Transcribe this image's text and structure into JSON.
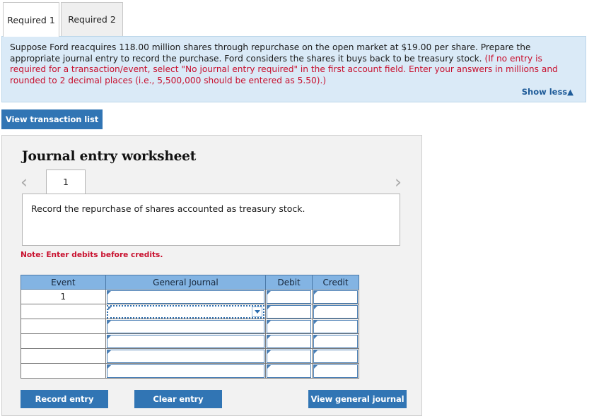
{
  "tabs": [
    {
      "label": "Required 1",
      "active": true
    },
    {
      "label": "Required 2",
      "active": false
    }
  ],
  "instructions": {
    "segment_1": "Suppose Ford reacquires 118.00 million shares through repurchase on the open market at $19.00 per share. Prepare the appropriate journal entry to record the purchase. Ford considers the shares it buys back to be treasury stock. ",
    "segment_2_red": "(If no entry is required for a transaction/event, select \"No journal entry required\" in the first account field. Enter your answers in millions and rounded to 2 decimal places (i.e., 5,500,000 should be entered as 5.50).)",
    "show_less_label": "Show less▲"
  },
  "toolbar": {
    "view_transaction_list_label": "View transaction list"
  },
  "worksheet": {
    "title": "Journal entry worksheet",
    "pager": {
      "prev_icon": "chevron-left-icon",
      "next_icon": "chevron-right-icon",
      "current_page": "1"
    },
    "description": "Record the repurchase of shares accounted as treasury stock.",
    "note": "Note: Enter debits before credits."
  },
  "table": {
    "columns": [
      "Event",
      "General Journal",
      "Debit",
      "Credit"
    ],
    "rows": [
      {
        "event": "1",
        "general_journal": "",
        "debit": "",
        "credit": "",
        "selected": false
      },
      {
        "event": "",
        "general_journal": "",
        "debit": "",
        "credit": "",
        "selected": true
      },
      {
        "event": "",
        "general_journal": "",
        "debit": "",
        "credit": "",
        "selected": false
      },
      {
        "event": "",
        "general_journal": "",
        "debit": "",
        "credit": "",
        "selected": false
      },
      {
        "event": "",
        "general_journal": "",
        "debit": "",
        "credit": "",
        "selected": false
      },
      {
        "event": "",
        "general_journal": "",
        "debit": "",
        "credit": "",
        "selected": false
      }
    ]
  },
  "actions": {
    "record_entry_label": "Record entry",
    "clear_entry_label": "Clear entry",
    "view_general_journal_label": "View general journal"
  },
  "colors": {
    "button_blue": "#3175b4",
    "table_header_blue": "#83b4e3",
    "instruction_bg": "#daeaf7",
    "alert_red": "#c8102e",
    "link_blue": "#1f5c99",
    "panel_bg": "#f2f2f2"
  }
}
